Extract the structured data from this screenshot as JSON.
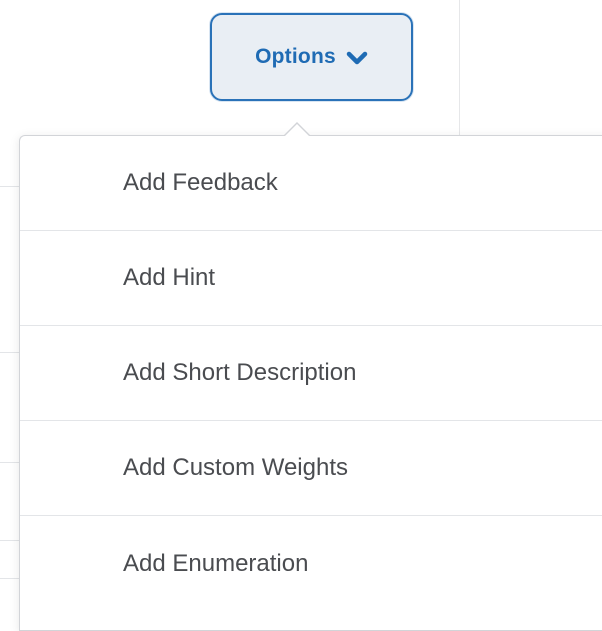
{
  "options_button": {
    "label": "Options",
    "icon": "chevron-down-icon"
  },
  "menu": {
    "items": [
      {
        "label": "Add Feedback"
      },
      {
        "label": "Add Hint"
      },
      {
        "label": "Add Short Description"
      },
      {
        "label": "Add Custom Weights"
      },
      {
        "label": "Add Enumeration"
      }
    ]
  },
  "colors": {
    "accent": "#1f6bb4",
    "button_bg": "#e9eef4",
    "menu_text": "#4a4c50",
    "divider": "#e3e5e8"
  }
}
